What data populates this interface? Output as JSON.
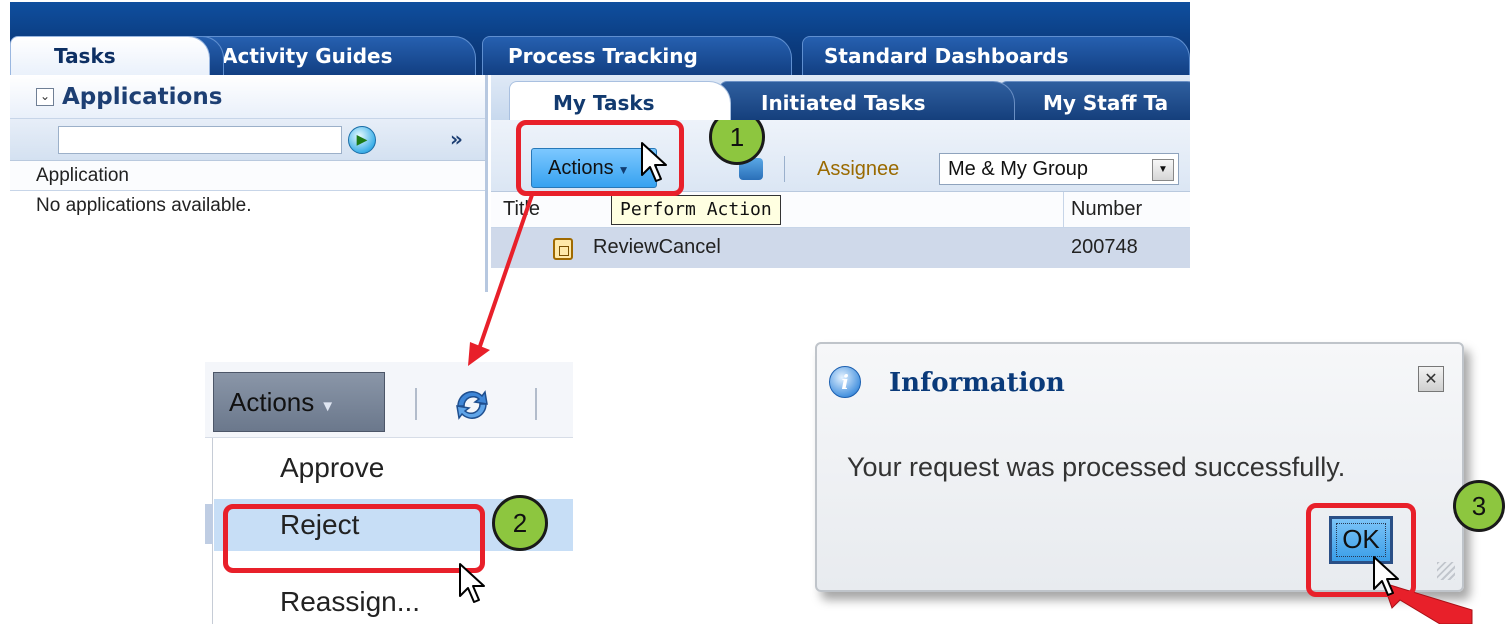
{
  "top_tabs": [
    {
      "label": "Tasks",
      "active": true
    },
    {
      "label": "Activity Guides",
      "active": false
    },
    {
      "label": "Process Tracking",
      "active": false
    },
    {
      "label": "Standard Dashboards",
      "active": false
    }
  ],
  "applications": {
    "title": "Applications",
    "expand_glyph": "»",
    "column_header": "Application",
    "empty_message": "No applications available."
  },
  "task_tabs": [
    {
      "label": "My Tasks",
      "active": true
    },
    {
      "label": "Initiated Tasks",
      "active": false
    },
    {
      "label": "My Staff Ta",
      "active": false
    }
  ],
  "toolbar": {
    "actions_label": "Actions",
    "assignee_label": "Assignee",
    "assignee_value": "Me & My Group"
  },
  "table": {
    "col_title": "Title",
    "col_number": "Number",
    "tooltip": "Perform Action",
    "rows": [
      {
        "title": "ReviewCancel",
        "number": "200748"
      }
    ]
  },
  "actions_menu": {
    "button_label": "Actions",
    "items": [
      "Approve",
      "Reject",
      "Reassign..."
    ]
  },
  "dialog": {
    "title": "Information",
    "message": "Your request was processed successfully.",
    "ok_label": "OK",
    "close_glyph": "✕"
  },
  "steps": [
    "1",
    "2",
    "3"
  ],
  "colors": {
    "callout_red": "#e8202a",
    "step_badge_green": "#8dc63f",
    "tab_bar_blue": "#0b3b7e"
  }
}
